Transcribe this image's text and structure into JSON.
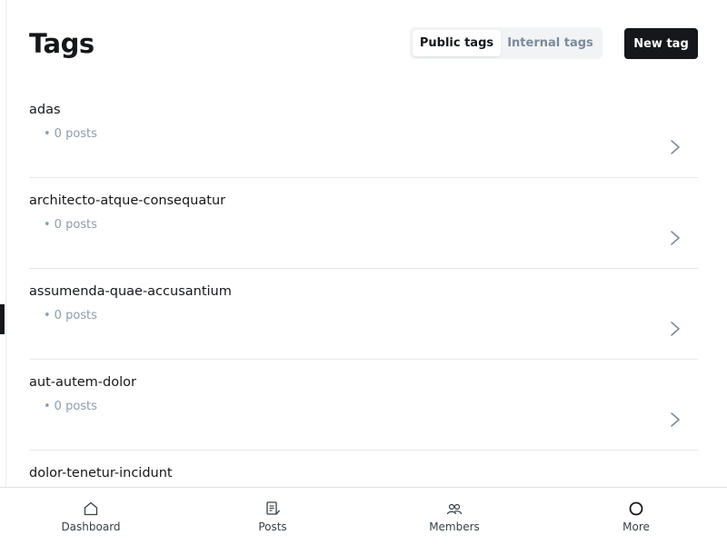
{
  "page": {
    "title": "Tags"
  },
  "tabs": [
    {
      "label": "Public tags",
      "active": true
    },
    {
      "label": "Internal tags",
      "active": false
    }
  ],
  "actions": {
    "new_tag_label": "New tag"
  },
  "tags": [
    {
      "name": "adas",
      "meta": "0 posts"
    },
    {
      "name": "architecto-atque-consequatur",
      "meta": "0 posts"
    },
    {
      "name": "assumenda-quae-accusantium",
      "meta": "0 posts"
    },
    {
      "name": "aut-autem-dolor",
      "meta": "0 posts"
    },
    {
      "name": "dolor-tenetur-incidunt",
      "meta": ""
    }
  ],
  "bottom_nav": [
    {
      "label": "Dashboard",
      "icon": "home-icon"
    },
    {
      "label": "Posts",
      "icon": "posts-icon"
    },
    {
      "label": "Members",
      "icon": "members-icon"
    },
    {
      "label": "More",
      "icon": "more-circle-icon"
    }
  ],
  "colors": {
    "primary": "#15171a",
    "muted": "#8e9cac",
    "tab_bg": "#f1f3f4",
    "border": "#e6e9eb"
  }
}
